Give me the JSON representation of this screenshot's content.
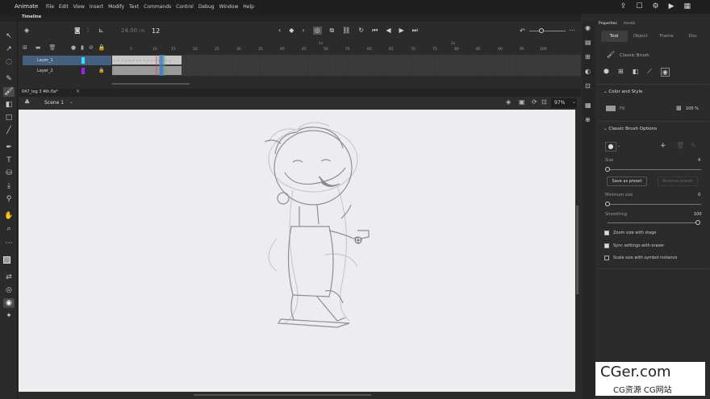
{
  "app": {
    "name": "Animate"
  },
  "menu": [
    "File",
    "Edit",
    "View",
    "Insert",
    "Modify",
    "Text",
    "Commands",
    "Control",
    "Debug",
    "Window",
    "Help"
  ],
  "timeline": {
    "tab": "Timeline",
    "fps": "24.00",
    "fps_unit": "FPS",
    "current_frame": "12",
    "ruler": [
      "5",
      "10",
      "15",
      "20",
      "25",
      "30",
      "35",
      "40",
      "45",
      "50",
      "55",
      "60",
      "65",
      "70",
      "75",
      "80",
      "85",
      "90",
      "95",
      "100"
    ],
    "ruler_marks": [
      "1s",
      "2s",
      "3s",
      "4s"
    ],
    "layers": [
      {
        "name": "Layer_1",
        "color": "#33e0ff",
        "selected": true
      },
      {
        "name": "Layer_2",
        "color": "#a020f0",
        "selected": false
      }
    ]
  },
  "document": {
    "tab": "047_log 3 4th.fla*",
    "scene": "Scene 1",
    "zoom": "97%"
  },
  "panel": {
    "tabs": [
      "Properties",
      "Assets"
    ],
    "subtabs": [
      "Tool",
      "Object",
      "Frame",
      "Doc"
    ],
    "tool_name": "Classic Brush",
    "color_style": {
      "title": "Color and Style",
      "fill_label": "Fill",
      "opacity": "100 %"
    },
    "brush_options": {
      "title": "Classic Brush Options",
      "size_label": "Size",
      "size_value": "4",
      "save_preset": "Save as preset",
      "remove_preset": "Remove preset",
      "min_size_label": "Minimum size",
      "min_size_value": "0",
      "smoothing_label": "Smoothing",
      "smoothing_value": "100",
      "checkboxes": [
        {
          "label": "Zoom size with stage",
          "checked": true
        },
        {
          "label": "Sync settings with eraser",
          "checked": true
        },
        {
          "label": "Scale size with symbol instance",
          "checked": false
        }
      ]
    }
  },
  "watermark": {
    "line1": "CGer.com",
    "line2": "CG资源 CG网站"
  }
}
